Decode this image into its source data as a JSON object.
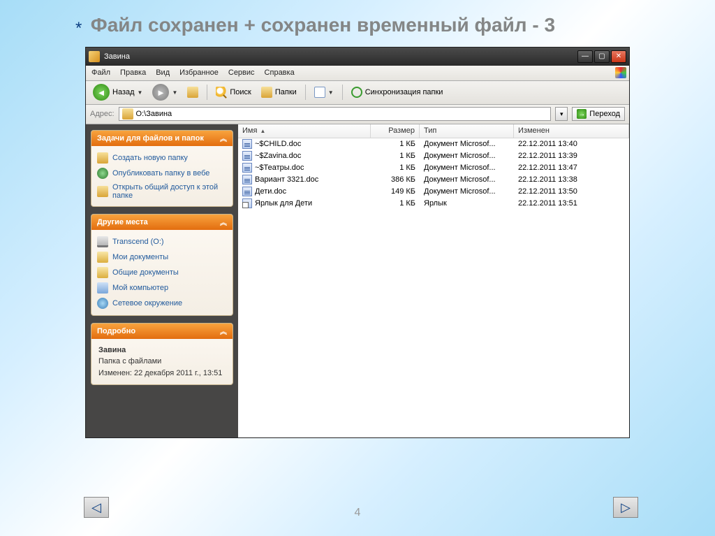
{
  "slide": {
    "asterisk": "*",
    "title": "Файл сохранен + сохранен временный файл - 3",
    "page_number": "4"
  },
  "window": {
    "title": "Завина",
    "menu": {
      "file": "Файл",
      "edit": "Правка",
      "view": "Вид",
      "fav": "Избранное",
      "tools": "Сервис",
      "help": "Справка"
    },
    "toolbar": {
      "back": "Назад",
      "search": "Поиск",
      "folders": "Папки",
      "sync": "Синхронизация папки"
    },
    "address": {
      "label": "Адрес:",
      "value": "O:\\Завина",
      "go": "Переход"
    }
  },
  "sidebar": {
    "tasks": {
      "title": "Задачи для файлов и папок",
      "new_folder": "Создать новую папку",
      "publish": "Опубликовать папку в вебе",
      "share": "Открыть общий доступ к этой папке"
    },
    "places": {
      "title": "Другие места",
      "drive": "Transcend (O:)",
      "mydocs": "Мои документы",
      "shared": "Общие документы",
      "pc": "Мой компьютер",
      "network": "Сетевое окружение"
    },
    "details": {
      "title": "Подробно",
      "name": "Завина",
      "type": "Папка с файлами",
      "modified": "Изменен: 22 декабря 2011 г., 13:51"
    }
  },
  "columns": {
    "name": "Имя",
    "size": "Размер",
    "type": "Тип",
    "modified": "Изменен"
  },
  "files": [
    {
      "name": "~$CHILD.doc",
      "size": "1 КБ",
      "type": "Документ Microsof...",
      "modified": "22.12.2011 13:40",
      "icon": "doc"
    },
    {
      "name": "~$Zavina.doc",
      "size": "1 КБ",
      "type": "Документ Microsof...",
      "modified": "22.12.2011 13:39",
      "icon": "doc"
    },
    {
      "name": "~$Театры.doc",
      "size": "1 КБ",
      "type": "Документ Microsof...",
      "modified": "22.12.2011 13:47",
      "icon": "doc"
    },
    {
      "name": "Вариант 3321.doc",
      "size": "386 КБ",
      "type": "Документ Microsof...",
      "modified": "22.12.2011 13:38",
      "icon": "doc"
    },
    {
      "name": "Дети.doc",
      "size": "149 КБ",
      "type": "Документ Microsof...",
      "modified": "22.12.2011 13:50",
      "icon": "doc"
    },
    {
      "name": "Ярлык для Дети",
      "size": "1 КБ",
      "type": "Ярлык",
      "modified": "22.12.2011 13:51",
      "icon": "shortcut"
    }
  ]
}
